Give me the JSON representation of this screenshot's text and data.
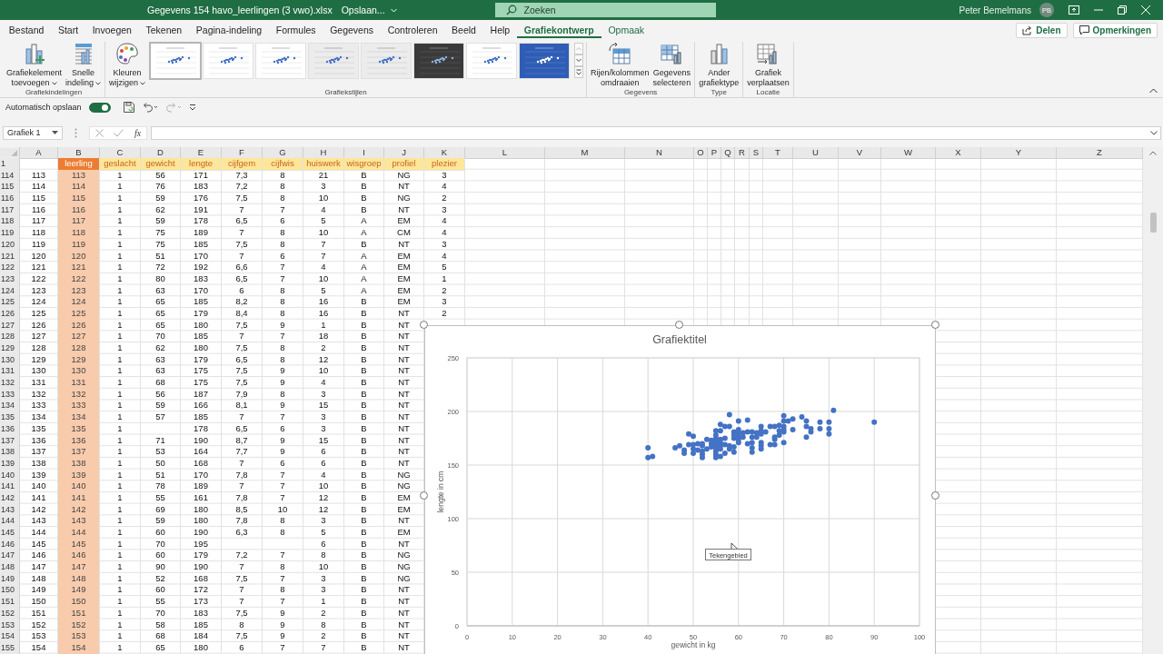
{
  "title_bar": {
    "file_name": "Gegevens 154 havo_leerlingen (3 vwo).xlsx",
    "save_status": "Opslaan...",
    "search": {
      "placeholder": "Zoeken"
    },
    "user": "Peter Bemelmans",
    "avatar": "PB"
  },
  "tabs": [
    {
      "label": "Bestand",
      "selected": false,
      "contextual": false
    },
    {
      "label": "Start",
      "selected": false,
      "contextual": false
    },
    {
      "label": "Invoegen",
      "selected": false,
      "contextual": false
    },
    {
      "label": "Tekenen",
      "selected": false,
      "contextual": false
    },
    {
      "label": "Pagina-indeling",
      "selected": false,
      "contextual": false
    },
    {
      "label": "Formules",
      "selected": false,
      "contextual": false
    },
    {
      "label": "Gegevens",
      "selected": false,
      "contextual": false
    },
    {
      "label": "Controleren",
      "selected": false,
      "contextual": false
    },
    {
      "label": "Beeld",
      "selected": false,
      "contextual": false
    },
    {
      "label": "Help",
      "selected": false,
      "contextual": false
    },
    {
      "label": "Grafiekontwerp",
      "selected": true,
      "contextual": true
    },
    {
      "label": "Opmaak",
      "selected": false,
      "contextual": true
    }
  ],
  "share_button": "Delen",
  "comments_button": "Opmerkingen",
  "ribbon_groups": [
    {
      "label": "Grafiekindelingen",
      "buttons": [
        {
          "lines": [
            "Grafiekelement",
            "toevoegen"
          ],
          "dropdown": true
        },
        {
          "lines": [
            "Snelle",
            "indeling"
          ],
          "dropdown": true
        }
      ]
    },
    {
      "label": "Grafiekstijlen",
      "buttons": [
        {
          "lines": [
            "Kleuren",
            "wijzigen"
          ],
          "dropdown": true
        }
      ],
      "gallery": [
        {
          "kind": "white",
          "selected": true
        },
        {
          "kind": "white",
          "selected": false
        },
        {
          "kind": "white",
          "selected": false
        },
        {
          "kind": "gray",
          "selected": false
        },
        {
          "kind": "gray",
          "selected": false
        },
        {
          "kind": "dark",
          "selected": false
        },
        {
          "kind": "white",
          "selected": false
        },
        {
          "kind": "blue",
          "selected": false
        }
      ]
    },
    {
      "label": "Gegevens",
      "buttons": [
        {
          "lines": [
            "Rijen/kolommen",
            "omdraaien"
          ],
          "dropdown": false
        },
        {
          "lines": [
            "Gegevens",
            "selecteren"
          ],
          "dropdown": false
        }
      ]
    },
    {
      "label": "Type",
      "buttons": [
        {
          "lines": [
            "Ander",
            "grafiektype"
          ],
          "dropdown": false
        }
      ]
    },
    {
      "label": "Locatie",
      "buttons": [
        {
          "lines": [
            "Grafiek",
            "verplaatsen"
          ],
          "dropdown": false
        }
      ]
    }
  ],
  "quick_access": {
    "autosave_label": "Automatisch opslaan",
    "autosave_on": true,
    "redo_disabled": true
  },
  "formula_bar": {
    "name_box": "Grafiek 1",
    "function_label": "fx"
  },
  "sheet": {
    "columns": [
      {
        "letter": "A",
        "kind": "plain"
      },
      {
        "letter": "B",
        "kind": "key"
      },
      {
        "letter": "C",
        "kind": "label"
      },
      {
        "letter": "D",
        "kind": "label"
      },
      {
        "letter": "E",
        "kind": "label"
      },
      {
        "letter": "F",
        "kind": "label"
      },
      {
        "letter": "G",
        "kind": "label"
      },
      {
        "letter": "H",
        "kind": "label"
      },
      {
        "letter": "I",
        "kind": "label"
      },
      {
        "letter": "J",
        "kind": "label"
      },
      {
        "letter": "K",
        "kind": "label"
      },
      {
        "letter": "L",
        "kind": "plain"
      },
      {
        "letter": "M",
        "kind": "plain"
      },
      {
        "letter": "N",
        "kind": "plain"
      },
      {
        "letter": "O",
        "kind": "plain"
      },
      {
        "letter": "P",
        "kind": "plain"
      },
      {
        "letter": "Q",
        "kind": "plain"
      },
      {
        "letter": "R",
        "kind": "plain"
      },
      {
        "letter": "S",
        "kind": "plain"
      },
      {
        "letter": "T",
        "kind": "plain"
      },
      {
        "letter": "U",
        "kind": "plain"
      },
      {
        "letter": "V",
        "kind": "plain"
      },
      {
        "letter": "W",
        "kind": "plain"
      },
      {
        "letter": "X",
        "kind": "plain"
      },
      {
        "letter": "Y",
        "kind": "plain"
      },
      {
        "letter": "Z",
        "kind": "plain"
      }
    ],
    "rows": [
      {
        "number": "1",
        "cells": [
          null,
          "leerling",
          "geslacht",
          "gewicht",
          "lengte",
          "cijfgem",
          "cijfwis",
          "huiswerk",
          "wisgroep",
          "profiel",
          "plezier"
        ]
      },
      {
        "number": "114",
        "cells": [
          "113",
          "113",
          "1",
          "56",
          "171",
          "7,3",
          "8",
          "21",
          "B",
          "NG",
          "3"
        ]
      },
      {
        "number": "115",
        "cells": [
          "114",
          "114",
          "1",
          "76",
          "183",
          "7,2",
          "8",
          "3",
          "B",
          "NT",
          "4"
        ]
      },
      {
        "number": "116",
        "cells": [
          "115",
          "115",
          "1",
          "59",
          "176",
          "7,5",
          "8",
          "10",
          "B",
          "NG",
          "2"
        ]
      },
      {
        "number": "117",
        "cells": [
          "116",
          "116",
          "1",
          "62",
          "191",
          "7",
          "7",
          "4",
          "B",
          "NT",
          "3"
        ]
      },
      {
        "number": "118",
        "cells": [
          "117",
          "117",
          "1",
          "59",
          "178",
          "6,5",
          "6",
          "5",
          "A",
          "EM",
          "4"
        ]
      },
      {
        "number": "119",
        "cells": [
          "118",
          "118",
          "1",
          "75",
          "189",
          "7",
          "8",
          "10",
          "A",
          "CM",
          "4"
        ]
      },
      {
        "number": "120",
        "cells": [
          "119",
          "119",
          "1",
          "75",
          "185",
          "7,5",
          "8",
          "7",
          "B",
          "NT",
          "3"
        ]
      },
      {
        "number": "121",
        "cells": [
          "120",
          "120",
          "1",
          "51",
          "170",
          "7",
          "6",
          "7",
          "A",
          "EM",
          "4"
        ]
      },
      {
        "number": "122",
        "cells": [
          "121",
          "121",
          "1",
          "72",
          "192",
          "6,6",
          "7",
          "4",
          "A",
          "EM",
          "5"
        ]
      },
      {
        "number": "123",
        "cells": [
          "122",
          "122",
          "1",
          "80",
          "183",
          "6,5",
          "7",
          "10",
          "A",
          "EM",
          "1"
        ]
      },
      {
        "number": "124",
        "cells": [
          "123",
          "123",
          "1",
          "63",
          "170",
          "6",
          "8",
          "5",
          "A",
          "EM",
          "2"
        ]
      },
      {
        "number": "125",
        "cells": [
          "124",
          "124",
          "1",
          "65",
          "185",
          "8,2",
          "8",
          "16",
          "B",
          "EM",
          "3"
        ]
      },
      {
        "number": "126",
        "cells": [
          "125",
          "125",
          "1",
          "65",
          "179",
          "8,4",
          "8",
          "16",
          "B",
          "NT",
          "2"
        ]
      },
      {
        "number": "127",
        "cells": [
          "126",
          "126",
          "1",
          "65",
          "180",
          "7,5",
          "9",
          "1",
          "B",
          "NT"
        ]
      },
      {
        "number": "128",
        "cells": [
          "127",
          "127",
          "1",
          "70",
          "185",
          "7",
          "7",
          "18",
          "B",
          "NT"
        ]
      },
      {
        "number": "129",
        "cells": [
          "128",
          "128",
          "1",
          "62",
          "180",
          "7,5",
          "8",
          "2",
          "B",
          "NT"
        ]
      },
      {
        "number": "130",
        "cells": [
          "129",
          "129",
          "1",
          "63",
          "179",
          "6,5",
          "8",
          "12",
          "B",
          "NT"
        ]
      },
      {
        "number": "131",
        "cells": [
          "130",
          "130",
          "1",
          "63",
          "175",
          "7,5",
          "9",
          "10",
          "B",
          "NT"
        ]
      },
      {
        "number": "132",
        "cells": [
          "131",
          "131",
          "1",
          "68",
          "175",
          "7,5",
          "9",
          "4",
          "B",
          "NT"
        ]
      },
      {
        "number": "133",
        "cells": [
          "132",
          "132",
          "1",
          "56",
          "187",
          "7,9",
          "8",
          "3",
          "B",
          "NT"
        ]
      },
      {
        "number": "134",
        "cells": [
          "133",
          "133",
          "1",
          "59",
          "166",
          "8,1",
          "9",
          "15",
          "B",
          "NT"
        ]
      },
      {
        "number": "135",
        "cells": [
          "134",
          "134",
          "1",
          "57",
          "185",
          "7",
          "7",
          "3",
          "B",
          "NT"
        ]
      },
      {
        "number": "136",
        "cells": [
          "135",
          "135",
          "1",
          null,
          "178",
          "6,5",
          "6",
          "3",
          "B",
          "NT"
        ]
      },
      {
        "number": "137",
        "cells": [
          "136",
          "136",
          "1",
          "71",
          "190",
          "8,7",
          "9",
          "15",
          "B",
          "NT"
        ]
      },
      {
        "number": "138",
        "cells": [
          "137",
          "137",
          "1",
          "53",
          "164",
          "7,7",
          "9",
          "6",
          "B",
          "NT"
        ]
      },
      {
        "number": "139",
        "cells": [
          "138",
          "138",
          "1",
          "50",
          "168",
          "7",
          "6",
          "6",
          "B",
          "NT"
        ]
      },
      {
        "number": "140",
        "cells": [
          "139",
          "139",
          "1",
          "51",
          "170",
          "7,8",
          "7",
          "4",
          "B",
          "NG"
        ]
      },
      {
        "number": "141",
        "cells": [
          "140",
          "140",
          "1",
          "78",
          "189",
          "7",
          "7",
          "10",
          "B",
          "NG"
        ]
      },
      {
        "number": "142",
        "cells": [
          "141",
          "141",
          "1",
          "55",
          "161",
          "7,8",
          "7",
          "12",
          "B",
          "EM"
        ]
      },
      {
        "number": "143",
        "cells": [
          "142",
          "142",
          "1",
          "69",
          "180",
          "8,5",
          "10",
          "12",
          "B",
          "EM"
        ]
      },
      {
        "number": "144",
        "cells": [
          "143",
          "143",
          "1",
          "59",
          "180",
          "7,8",
          "8",
          "3",
          "B",
          "NT"
        ]
      },
      {
        "number": "145",
        "cells": [
          "144",
          "144",
          "1",
          "60",
          "190",
          "6,3",
          "8",
          "5",
          "B",
          "EM"
        ]
      },
      {
        "number": "146",
        "cells": [
          "145",
          "145",
          "1",
          "70",
          "195",
          null,
          null,
          "6",
          "B",
          "NT"
        ]
      },
      {
        "number": "147",
        "cells": [
          "146",
          "146",
          "1",
          "60",
          "179",
          "7,2",
          "7",
          "8",
          "B",
          "NG"
        ]
      },
      {
        "number": "148",
        "cells": [
          "147",
          "147",
          "1",
          "90",
          "190",
          "7",
          "8",
          "10",
          "B",
          "NG"
        ]
      },
      {
        "number": "149",
        "cells": [
          "148",
          "148",
          "1",
          "52",
          "168",
          "7,5",
          "7",
          "3",
          "B",
          "NG"
        ]
      },
      {
        "number": "150",
        "cells": [
          "149",
          "149",
          "1",
          "60",
          "172",
          "7",
          "8",
          "3",
          "B",
          "NT"
        ]
      },
      {
        "number": "151",
        "cells": [
          "150",
          "150",
          "1",
          "55",
          "173",
          "7",
          "7",
          "1",
          "B",
          "NT"
        ]
      },
      {
        "number": "152",
        "cells": [
          "151",
          "151",
          "1",
          "70",
          "183",
          "7,5",
          "9",
          "2",
          "B",
          "NT"
        ]
      },
      {
        "number": "153",
        "cells": [
          "152",
          "152",
          "1",
          "58",
          "185",
          "8",
          "9",
          "8",
          "B",
          "NT"
        ]
      },
      {
        "number": "154",
        "cells": [
          "153",
          "153",
          "1",
          "68",
          "184",
          "7,5",
          "9",
          "2",
          "B",
          "NT"
        ]
      },
      {
        "number": "155",
        "cells": [
          "154",
          "154",
          "1",
          "65",
          "180",
          "6",
          "7",
          "7",
          "B",
          "NT"
        ]
      }
    ]
  },
  "chart": {
    "tooltip": "Tekengebied",
    "chart_data": {
      "type": "scatter",
      "grid": true,
      "title": "Grafiektitel",
      "xlabel": "gewicht in kg",
      "ylabel": "lengte in cm",
      "xlim": [
        0,
        100
      ],
      "ylim": [
        0,
        250
      ],
      "xticks": [
        0,
        10,
        20,
        30,
        40,
        50,
        60,
        70,
        80,
        90,
        100
      ],
      "yticks": [
        0,
        50,
        100,
        150,
        200,
        250
      ],
      "x": [
        40,
        40,
        41,
        46,
        47,
        48,
        48,
        49,
        49,
        50,
        50,
        50,
        50,
        51,
        51,
        52,
        52,
        52,
        52,
        52,
        53,
        53,
        54,
        54,
        54,
        55,
        55,
        55,
        55,
        55,
        55,
        55,
        55,
        55,
        56,
        56,
        56,
        56,
        56,
        56,
        56,
        57,
        57,
        57,
        57,
        58,
        58,
        58,
        58,
        59,
        59,
        59,
        59,
        59,
        60,
        60,
        60,
        60,
        60,
        60,
        61,
        61,
        62,
        62,
        62,
        63,
        63,
        63,
        63,
        63,
        64,
        64,
        65,
        65,
        65,
        65,
        65,
        65,
        66,
        67,
        67,
        68,
        68,
        68,
        68,
        69,
        69,
        69,
        70,
        70,
        70,
        70,
        70,
        70,
        71,
        72,
        72,
        74,
        75,
        75,
        75,
        76,
        76,
        78,
        78,
        80,
        80,
        80,
        81,
        90
      ],
      "series": [
        {
          "color": "#4472c4",
          "values": [
            166,
            157,
            158,
            166,
            168,
            164,
            161,
            179,
            169,
            177,
            169,
            165,
            161,
            170,
            164,
            170,
            168,
            163,
            160,
            157,
            174,
            165,
            173,
            170,
            167,
            182,
            178,
            175,
            172,
            169,
            166,
            163,
            160,
            157,
            188,
            182,
            174,
            171,
            168,
            165,
            158,
            186,
            175,
            169,
            161,
            197,
            186,
            168,
            165,
            181,
            178,
            175,
            167,
            162,
            191,
            183,
            180,
            177,
            174,
            171,
            180,
            176,
            192,
            181,
            170,
            181,
            176,
            171,
            166,
            162,
            180,
            176,
            186,
            182,
            179,
            171,
            168,
            165,
            181,
            186,
            169,
            186,
            176,
            174,
            169,
            187,
            182,
            178,
            196,
            191,
            186,
            183,
            181,
            171,
            191,
            193,
            183,
            195,
            191,
            186,
            176,
            184,
            181,
            190,
            184,
            190,
            184,
            179,
            201,
            190
          ]
        }
      ]
    }
  }
}
